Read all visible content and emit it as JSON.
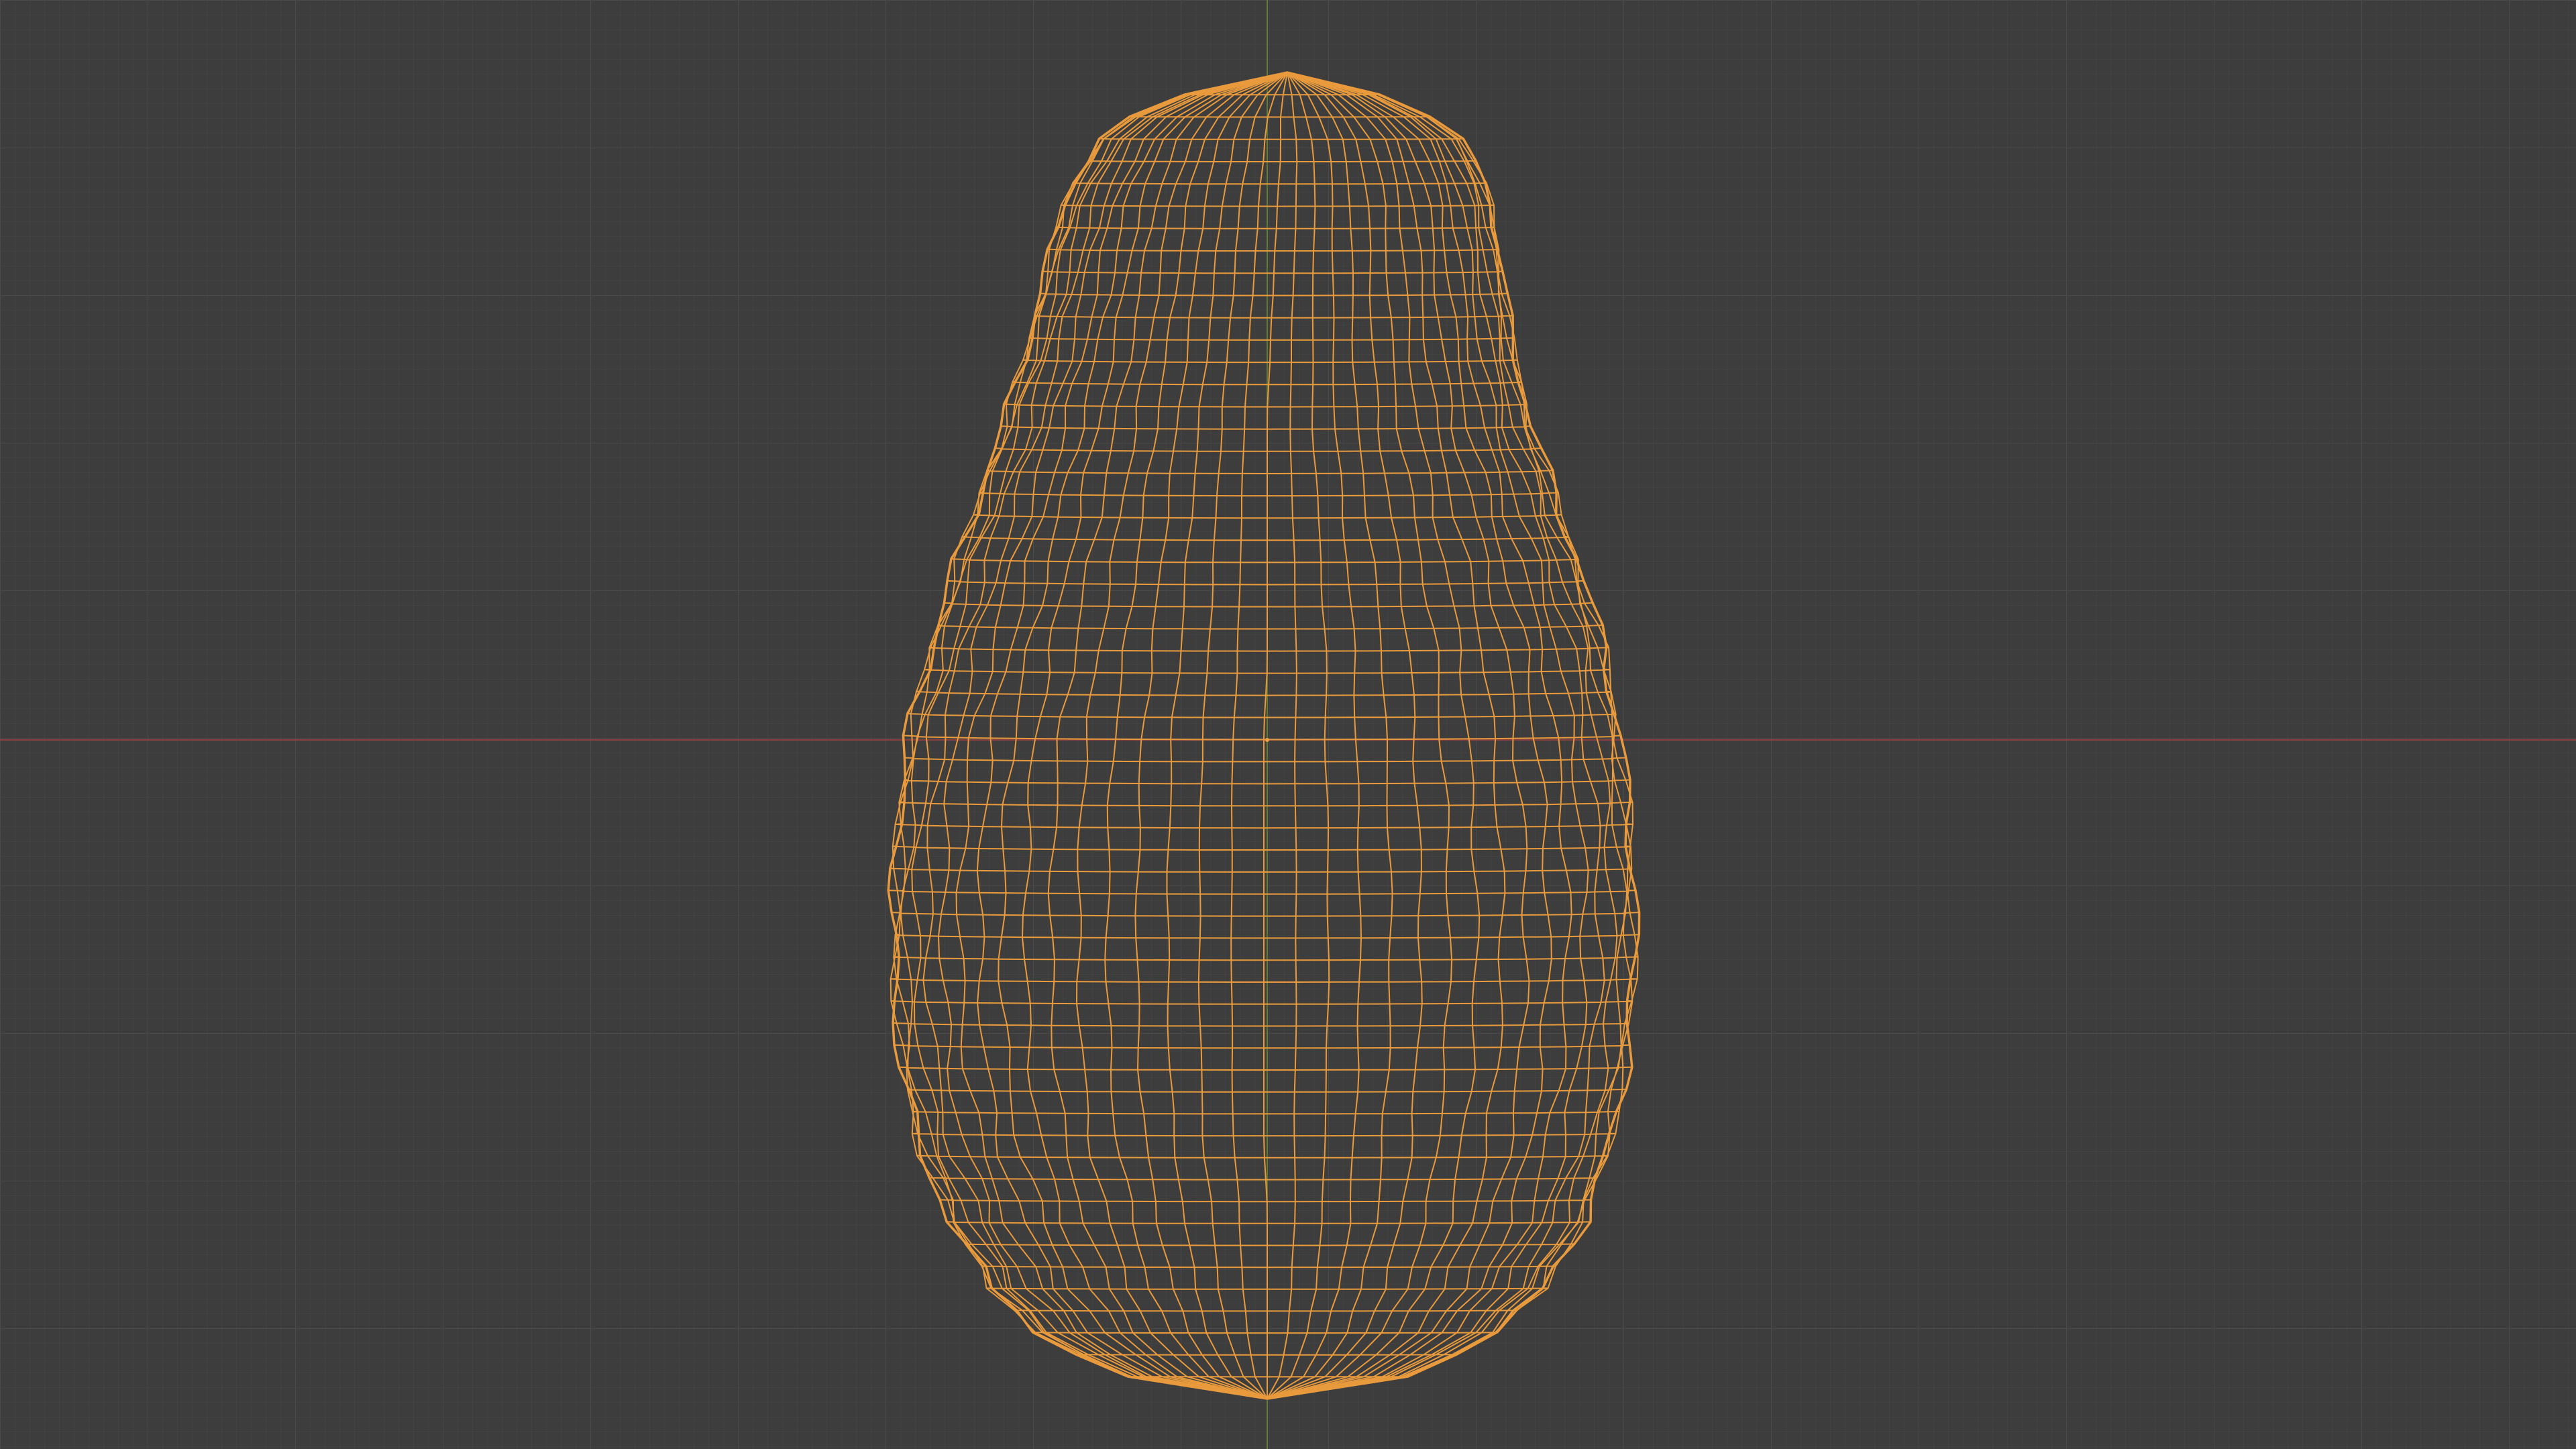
{
  "viewport": {
    "view": "front-orthographic",
    "shading": "wireframe",
    "background_color": "#3d3d3d",
    "grid_minor_color": "#454545",
    "grid_major_color": "#4c4c4c",
    "x_axis_color": "#9b4a4a",
    "z_axis_color": "#6b8a3a",
    "wireframe_color": "#e89a3c",
    "origin_icon": "origin-dot-icon"
  },
  "object": {
    "name_visible": false,
    "shape": "pear-mesh",
    "selected": true
  }
}
